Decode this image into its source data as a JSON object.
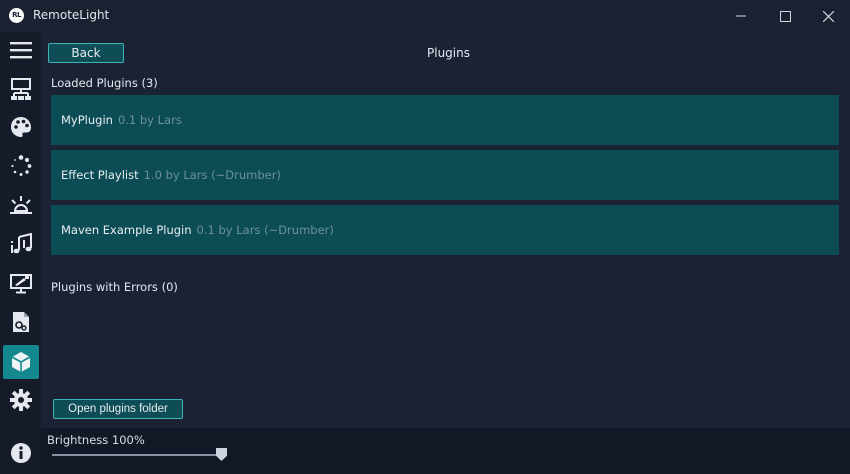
{
  "window": {
    "title": "RemoteLight",
    "logo_text": "RL"
  },
  "sidebar": {
    "items": [
      {
        "name": "menu-icon",
        "label": "Menu"
      },
      {
        "name": "network-icon",
        "label": "Outputs"
      },
      {
        "name": "palette-icon",
        "label": "Colors"
      },
      {
        "name": "animation-icon",
        "label": "Animations"
      },
      {
        "name": "scene-icon",
        "label": "Scenes"
      },
      {
        "name": "music-sync-icon",
        "label": "Music Sync"
      },
      {
        "name": "screen-color-icon",
        "label": "Screen Color"
      },
      {
        "name": "scripts-icon",
        "label": "Scripts"
      },
      {
        "name": "plugins-icon",
        "label": "Plugins",
        "active": true
      },
      {
        "name": "settings-icon",
        "label": "Settings"
      },
      {
        "name": "info-icon",
        "label": "About"
      }
    ]
  },
  "main": {
    "back_label": "Back",
    "page_title": "Plugins",
    "loaded_header": "Loaded Plugins (3)",
    "plugins": [
      {
        "name": "MyPlugin",
        "meta": "0.1 by Lars"
      },
      {
        "name": "Effect Playlist",
        "meta": "1.0 by Lars (~Drumber)"
      },
      {
        "name": "Maven Example Plugin",
        "meta": "0.1 by Lars (~Drumber)"
      }
    ],
    "errors_header": "Plugins with Errors (0)",
    "open_folder_label": "Open plugins folder"
  },
  "bottom": {
    "brightness_label": "Brightness 100%",
    "brightness_value": 100
  },
  "colors": {
    "background": "#1b2233",
    "sidebar": "#151b29",
    "accent": "#13898f",
    "row": "#0b4c55",
    "button_border": "#3fb3b5"
  }
}
